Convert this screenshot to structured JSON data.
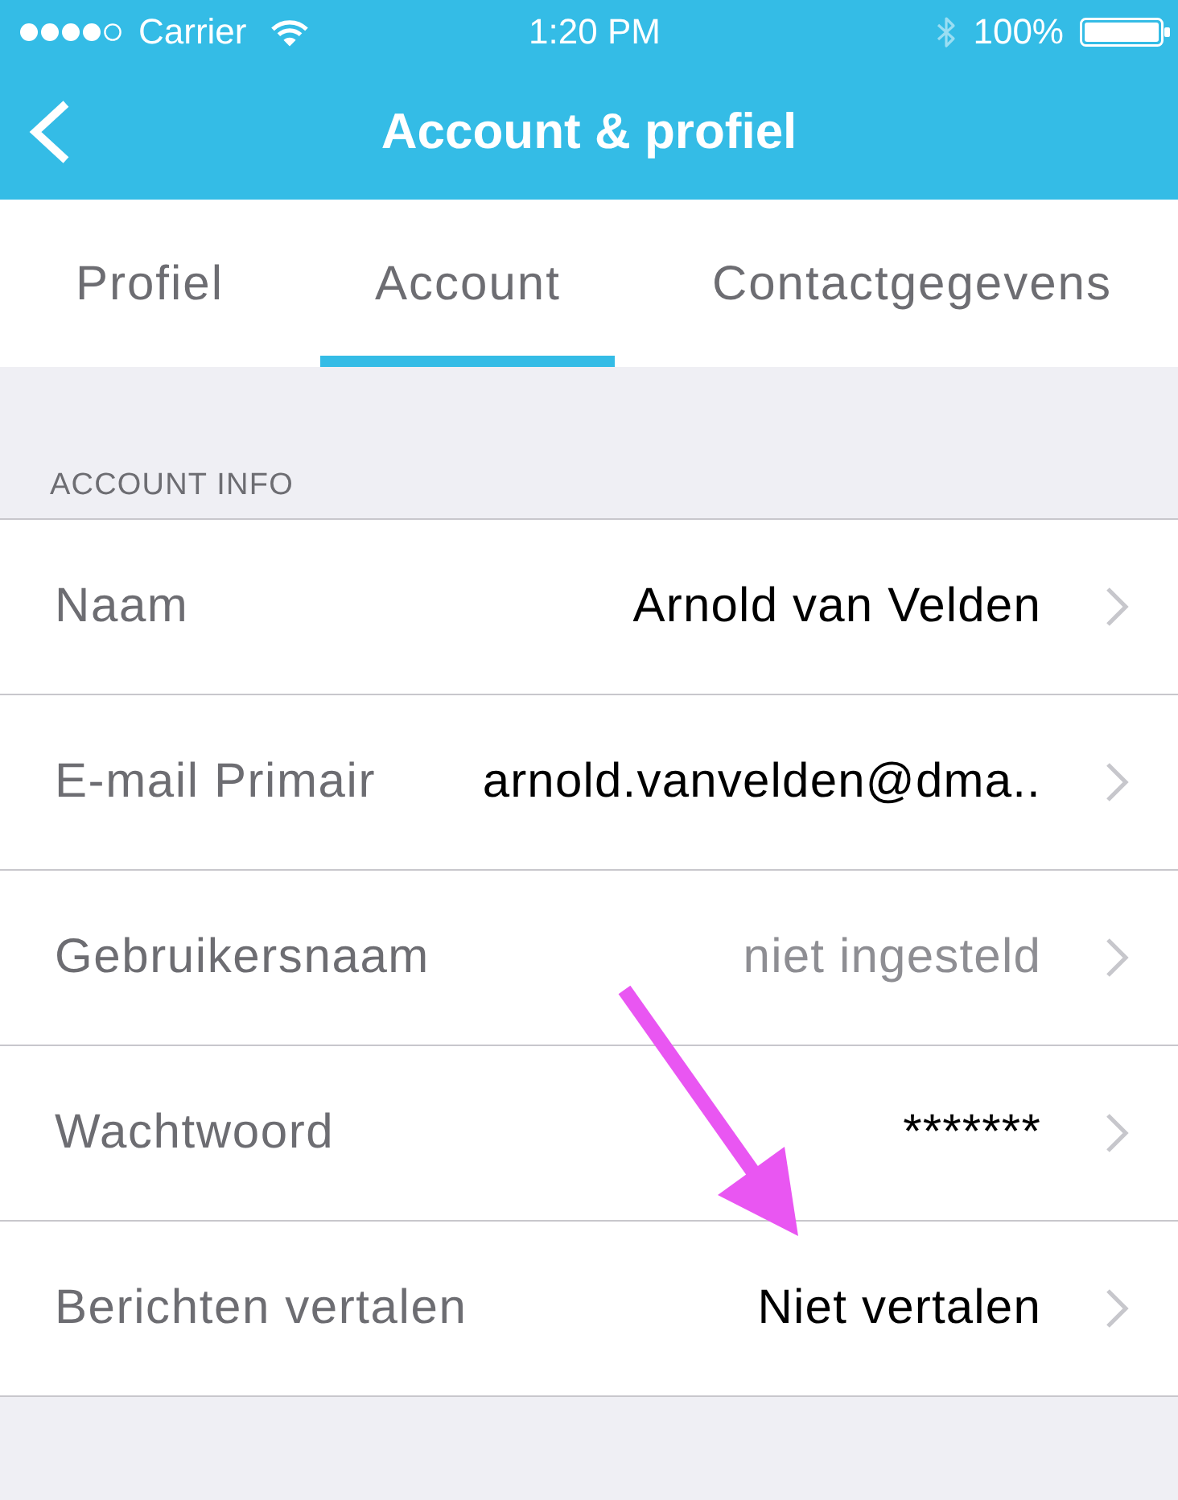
{
  "status_bar": {
    "carrier": "Carrier",
    "time": "1:20 PM",
    "battery": "100%"
  },
  "nav_bar": {
    "title": "Account & profiel"
  },
  "tabs": [
    {
      "label": "Profiel",
      "selected": false
    },
    {
      "label": "Account",
      "selected": true
    },
    {
      "label": "Contactgegevens",
      "selected": false
    }
  ],
  "account_info": {
    "header": "ACCOUNT INFO",
    "rows": [
      {
        "label": "Naam",
        "value": "Arnold van Velden",
        "is_set": true
      },
      {
        "label": "E-mail Primair",
        "value": "arnold.vanvelden@dma..",
        "is_set": true
      },
      {
        "label": "Gebruikersnaam",
        "value": "niet ingesteld",
        "is_set": false
      },
      {
        "label": "Wachtwoord",
        "value": "*******",
        "is_set": true
      },
      {
        "label": "Berichten vertalen",
        "value": "Niet vertalen",
        "is_set": true
      }
    ]
  }
}
